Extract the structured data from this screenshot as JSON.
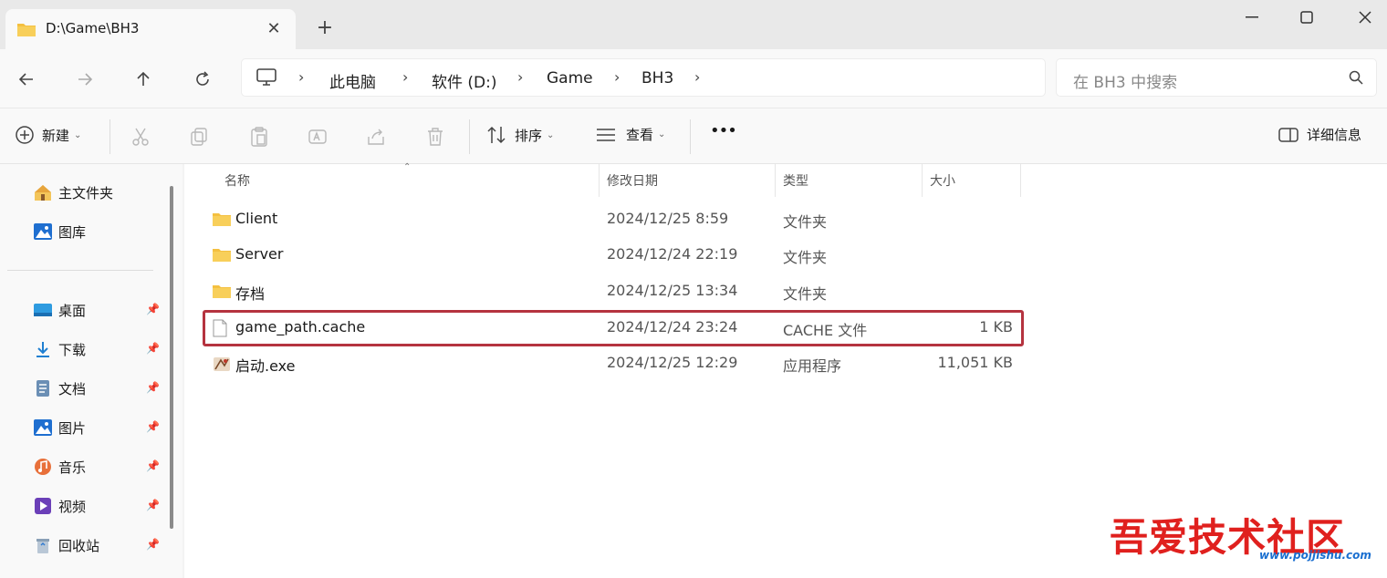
{
  "tab": {
    "title": "D:\\Game\\BH3",
    "close": "✕",
    "new": "+"
  },
  "window": {
    "minimize": "—",
    "maximize": "☐",
    "close": "✕"
  },
  "breadcrumb": {
    "items": [
      "此电脑",
      "软件 (D:)",
      "Game",
      "BH3"
    ],
    "separator": "›"
  },
  "search": {
    "placeholder": "在 BH3 中搜索"
  },
  "commands": {
    "new_label": "新建",
    "sort_label": "排序",
    "view_label": "查看",
    "more": "•••",
    "details_label": "详细信息"
  },
  "sidebar": {
    "items": [
      {
        "label": "主文件夹",
        "icon": "home-icon"
      },
      {
        "label": "图库",
        "icon": "gallery-icon"
      },
      {
        "label": "桌面",
        "icon": "desktop-icon"
      },
      {
        "label": "下载",
        "icon": "download-icon"
      },
      {
        "label": "文档",
        "icon": "document-icon"
      },
      {
        "label": "图片",
        "icon": "pictures-icon"
      },
      {
        "label": "音乐",
        "icon": "music-icon"
      },
      {
        "label": "视频",
        "icon": "video-icon"
      },
      {
        "label": "回收站",
        "icon": "recycle-bin-icon"
      }
    ]
  },
  "columns": {
    "name": "名称",
    "date": "修改日期",
    "type": "类型",
    "size": "大小"
  },
  "files": [
    {
      "name": "Client",
      "date": "2024/12/25 8:59",
      "type": "文件夹",
      "size": "",
      "icon": "folder-icon"
    },
    {
      "name": "Server",
      "date": "2024/12/24 22:19",
      "type": "文件夹",
      "size": "",
      "icon": "folder-icon"
    },
    {
      "name": "存档",
      "date": "2024/12/25 13:34",
      "type": "文件夹",
      "size": "",
      "icon": "folder-icon"
    },
    {
      "name": "game_path.cache",
      "date": "2024/12/24 23:24",
      "type": "CACHE 文件",
      "size": "1 KB",
      "icon": "file-icon"
    },
    {
      "name": "启动.exe",
      "date": "2024/12/25 12:29",
      "type": "应用程序",
      "size": "11,051 KB",
      "icon": "exe-icon"
    }
  ],
  "watermark": {
    "text": "吾爱技术社区",
    "url": "www.pojjishu.com"
  },
  "colors": {
    "highlight": "#b5333f",
    "folder": "#f4c040",
    "watermark": "#e0201e"
  }
}
